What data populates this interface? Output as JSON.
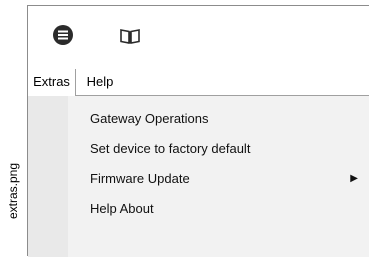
{
  "caption": "extras.png",
  "toolbar": {
    "icons": [
      "hamburger-menu-icon",
      "book-icon"
    ]
  },
  "menubar": {
    "items": [
      {
        "label": "Extras",
        "active": true
      },
      {
        "label": "Help",
        "active": false
      }
    ]
  },
  "dropdown": {
    "items": [
      {
        "label": "Gateway Operations",
        "submenu": false
      },
      {
        "label": "Set device to factory default",
        "submenu": false
      },
      {
        "label": "Firmware Update",
        "submenu": true,
        "arrow": "▶"
      },
      {
        "label": "Help About",
        "submenu": false
      }
    ]
  },
  "colors": {
    "menu_background": "#f2f2f2",
    "icon": "#2b2b2b"
  }
}
